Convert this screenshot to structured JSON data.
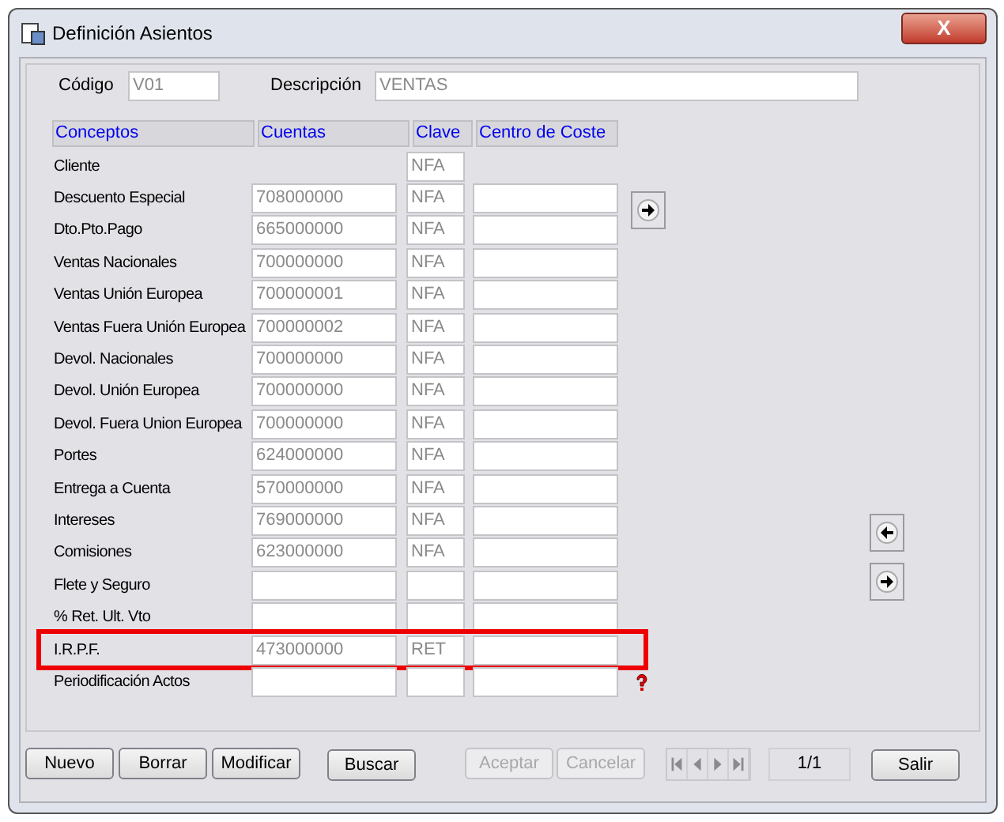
{
  "window": {
    "title": "Definición Asientos",
    "close": "X"
  },
  "header": {
    "codigo_label": "Código",
    "codigo_value": "V01",
    "descripcion_label": "Descripción",
    "descripcion_value": "VENTAS"
  },
  "table": {
    "columns": [
      "Conceptos",
      "Cuentas",
      "Clave",
      "Centro de Coste"
    ],
    "rows": [
      {
        "kind": "clave_only",
        "concepto": "Cliente",
        "clave": "NFA",
        "highlighted": false
      },
      {
        "kind": "full",
        "concepto": "Descuento Especial",
        "cuenta": "708000000",
        "clave": "NFA",
        "highlighted": false
      },
      {
        "kind": "full",
        "concepto": "Dto.Pto.Pago",
        "cuenta": "665000000",
        "clave": "NFA",
        "highlighted": false
      },
      {
        "kind": "full",
        "concepto": "Ventas Nacionales",
        "cuenta": "700000000",
        "clave": "NFA",
        "highlighted": false
      },
      {
        "kind": "full",
        "concepto": "Ventas Unión Europea",
        "cuenta": "700000001",
        "clave": "NFA",
        "highlighted": false
      },
      {
        "kind": "full",
        "concepto": "Ventas Fuera Unión Europea",
        "cuenta": "700000002",
        "clave": "NFA",
        "highlighted": false
      },
      {
        "kind": "full",
        "concepto": "Devol. Nacionales",
        "cuenta": "700000000",
        "clave": "NFA",
        "highlighted": false
      },
      {
        "kind": "full",
        "concepto": "Devol. Unión Europea",
        "cuenta": "700000000",
        "clave": "NFA",
        "highlighted": false
      },
      {
        "kind": "full",
        "concepto": "Devol. Fuera Union Europea",
        "cuenta": "700000000",
        "clave": "NFA",
        "highlighted": false
      },
      {
        "kind": "full",
        "concepto": "Portes",
        "cuenta": "624000000",
        "clave": "NFA",
        "highlighted": false
      },
      {
        "kind": "full",
        "concepto": "Entrega a Cuenta",
        "cuenta": "570000000",
        "clave": "NFA",
        "highlighted": false
      },
      {
        "kind": "full",
        "concepto": "Intereses",
        "cuenta": "769000000",
        "clave": "NFA",
        "highlighted": false
      },
      {
        "kind": "full",
        "concepto": "Comisiones",
        "cuenta": "623000000",
        "clave": "NFA",
        "highlighted": false
      },
      {
        "kind": "full",
        "concepto": "Flete y Seguro",
        "highlighted": false
      },
      {
        "kind": "full",
        "concepto": "% Ret. Ult. Vto",
        "highlighted": false
      },
      {
        "kind": "full",
        "concepto": "I.R.P.F.",
        "cuenta": "473000000",
        "clave": "RET",
        "highlighted": true
      },
      {
        "kind": "full",
        "concepto": "Periodificación Actos",
        "highlighted": false
      }
    ]
  },
  "buttons": [
    {
      "label": "Nuevo",
      "disabled": false
    },
    {
      "label": "Borrar",
      "disabled": false
    },
    {
      "label": "Modificar",
      "disabled": false
    },
    {
      "label": "Buscar",
      "disabled": false
    },
    {
      "label": "Aceptar",
      "disabled": true
    },
    {
      "label": "Cancelar",
      "disabled": true
    }
  ],
  "pager": {
    "position": "1/1"
  },
  "exit_button": {
    "label": "Salir",
    "disabled": false
  }
}
